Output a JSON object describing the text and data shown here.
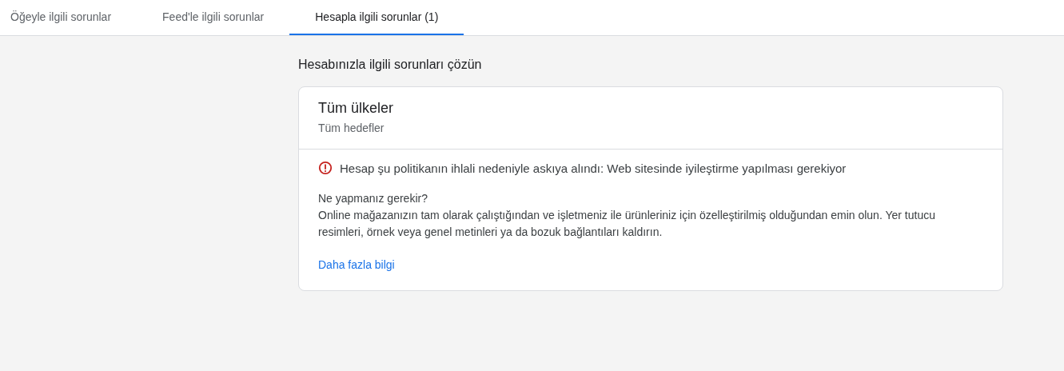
{
  "tabs": [
    {
      "label": "Öğeyle ilgili sorunlar",
      "selected": false
    },
    {
      "label": "Feed'le ilgili sorunlar",
      "selected": false
    },
    {
      "label": "Hesapla ilgili sorunlar (1)",
      "selected": true
    }
  ],
  "heading": "Hesabınızla ilgili sorunları çözün",
  "card": {
    "title": "Tüm ülkeler",
    "subtitle": "Tüm hedefler",
    "issue": {
      "message": "Hesap şu politikanın ihlali nedeniyle askıya alındı: Web sitesinde iyileştirme yapılması gerekiyor",
      "question": "Ne yapmanız gerekir?",
      "description": "Online mağazanızın tam olarak çalıştığından ve işletmeniz ile ürünleriniz için özelleştirilmiş olduğundan emin olun. Yer tutucu resimleri, örnek veya genel metinleri ya da bozuk bağlantıları kaldırın.",
      "link": "Daha fazla bilgi"
    }
  }
}
